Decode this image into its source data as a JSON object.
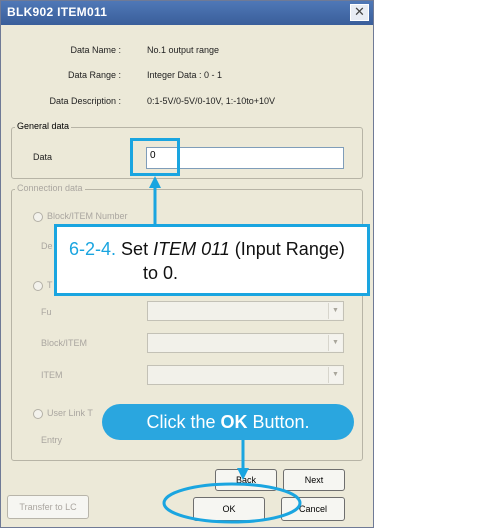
{
  "window": {
    "title": "BLK902 ITEM011",
    "close_glyph": "✕"
  },
  "info": {
    "data_name_label": "Data Name :",
    "data_name_value": "No.1 output range",
    "data_range_label": "Data Range :",
    "data_range_value": "Integer Data : 0 - 1",
    "data_desc_label": "Data Description :",
    "data_desc_value": "0:1-5V/0-5V/0-10V, 1:-10to+10V"
  },
  "general": {
    "title": "General data",
    "data_label": "Data",
    "data_value": "0"
  },
  "connection": {
    "title": "Connection data",
    "radio_block_item": "Block/ITEM Number",
    "de_label": "De",
    "radio_t_label": "T",
    "fu_label": "Fu",
    "block_item_label": "Block/ITEM",
    "item_label": "ITEM",
    "radio_user_link": "User Link T",
    "entry_label": "Entry"
  },
  "buttons": {
    "back": "Back",
    "next": "Next",
    "transfer": "Transfer to LC",
    "ok": "OK",
    "cancel": "Cancel"
  },
  "annotations": {
    "step_number": "6-2-4.",
    "step_text_pre": "Set ",
    "step_item": "ITEM 011",
    "step_text_post": " (Input Range)",
    "step_line2": "to 0.",
    "ok_pre": "Click the ",
    "ok_bold": "OK",
    "ok_post": " Button.",
    "accent_color": "#1aa5e0"
  }
}
